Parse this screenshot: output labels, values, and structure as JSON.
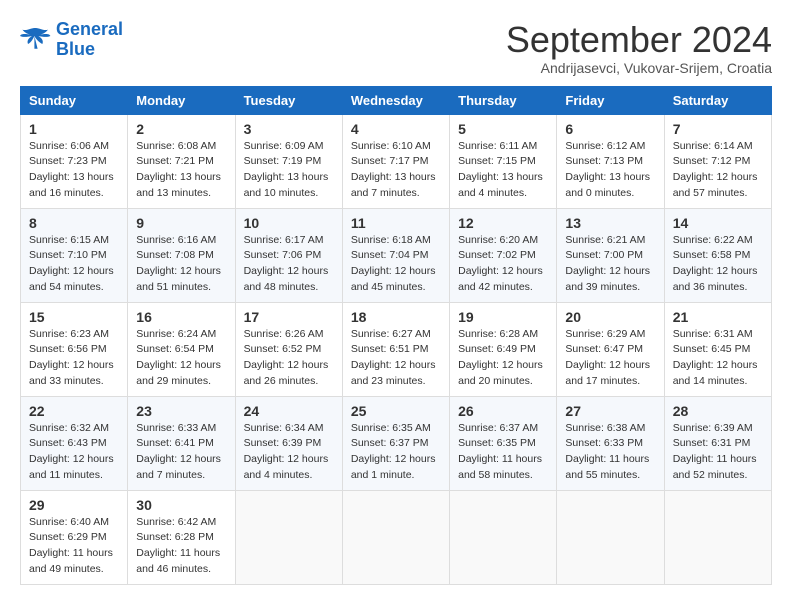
{
  "logo": {
    "line1": "General",
    "line2": "Blue"
  },
  "title": "September 2024",
  "subtitle": "Andrijasevci, Vukovar-Srijem, Croatia",
  "weekdays": [
    "Sunday",
    "Monday",
    "Tuesday",
    "Wednesday",
    "Thursday",
    "Friday",
    "Saturday"
  ],
  "weeks": [
    [
      {
        "day": "1",
        "sunrise": "6:06 AM",
        "sunset": "7:23 PM",
        "daylight": "13 hours and 16 minutes."
      },
      {
        "day": "2",
        "sunrise": "6:08 AM",
        "sunset": "7:21 PM",
        "daylight": "13 hours and 13 minutes."
      },
      {
        "day": "3",
        "sunrise": "6:09 AM",
        "sunset": "7:19 PM",
        "daylight": "13 hours and 10 minutes."
      },
      {
        "day": "4",
        "sunrise": "6:10 AM",
        "sunset": "7:17 PM",
        "daylight": "13 hours and 7 minutes."
      },
      {
        "day": "5",
        "sunrise": "6:11 AM",
        "sunset": "7:15 PM",
        "daylight": "13 hours and 4 minutes."
      },
      {
        "day": "6",
        "sunrise": "6:12 AM",
        "sunset": "7:13 PM",
        "daylight": "13 hours and 0 minutes."
      },
      {
        "day": "7",
        "sunrise": "6:14 AM",
        "sunset": "7:12 PM",
        "daylight": "12 hours and 57 minutes."
      }
    ],
    [
      {
        "day": "8",
        "sunrise": "6:15 AM",
        "sunset": "7:10 PM",
        "daylight": "12 hours and 54 minutes."
      },
      {
        "day": "9",
        "sunrise": "6:16 AM",
        "sunset": "7:08 PM",
        "daylight": "12 hours and 51 minutes."
      },
      {
        "day": "10",
        "sunrise": "6:17 AM",
        "sunset": "7:06 PM",
        "daylight": "12 hours and 48 minutes."
      },
      {
        "day": "11",
        "sunrise": "6:18 AM",
        "sunset": "7:04 PM",
        "daylight": "12 hours and 45 minutes."
      },
      {
        "day": "12",
        "sunrise": "6:20 AM",
        "sunset": "7:02 PM",
        "daylight": "12 hours and 42 minutes."
      },
      {
        "day": "13",
        "sunrise": "6:21 AM",
        "sunset": "7:00 PM",
        "daylight": "12 hours and 39 minutes."
      },
      {
        "day": "14",
        "sunrise": "6:22 AM",
        "sunset": "6:58 PM",
        "daylight": "12 hours and 36 minutes."
      }
    ],
    [
      {
        "day": "15",
        "sunrise": "6:23 AM",
        "sunset": "6:56 PM",
        "daylight": "12 hours and 33 minutes."
      },
      {
        "day": "16",
        "sunrise": "6:24 AM",
        "sunset": "6:54 PM",
        "daylight": "12 hours and 29 minutes."
      },
      {
        "day": "17",
        "sunrise": "6:26 AM",
        "sunset": "6:52 PM",
        "daylight": "12 hours and 26 minutes."
      },
      {
        "day": "18",
        "sunrise": "6:27 AM",
        "sunset": "6:51 PM",
        "daylight": "12 hours and 23 minutes."
      },
      {
        "day": "19",
        "sunrise": "6:28 AM",
        "sunset": "6:49 PM",
        "daylight": "12 hours and 20 minutes."
      },
      {
        "day": "20",
        "sunrise": "6:29 AM",
        "sunset": "6:47 PM",
        "daylight": "12 hours and 17 minutes."
      },
      {
        "day": "21",
        "sunrise": "6:31 AM",
        "sunset": "6:45 PM",
        "daylight": "12 hours and 14 minutes."
      }
    ],
    [
      {
        "day": "22",
        "sunrise": "6:32 AM",
        "sunset": "6:43 PM",
        "daylight": "12 hours and 11 minutes."
      },
      {
        "day": "23",
        "sunrise": "6:33 AM",
        "sunset": "6:41 PM",
        "daylight": "12 hours and 7 minutes."
      },
      {
        "day": "24",
        "sunrise": "6:34 AM",
        "sunset": "6:39 PM",
        "daylight": "12 hours and 4 minutes."
      },
      {
        "day": "25",
        "sunrise": "6:35 AM",
        "sunset": "6:37 PM",
        "daylight": "12 hours and 1 minute."
      },
      {
        "day": "26",
        "sunrise": "6:37 AM",
        "sunset": "6:35 PM",
        "daylight": "11 hours and 58 minutes."
      },
      {
        "day": "27",
        "sunrise": "6:38 AM",
        "sunset": "6:33 PM",
        "daylight": "11 hours and 55 minutes."
      },
      {
        "day": "28",
        "sunrise": "6:39 AM",
        "sunset": "6:31 PM",
        "daylight": "11 hours and 52 minutes."
      }
    ],
    [
      {
        "day": "29",
        "sunrise": "6:40 AM",
        "sunset": "6:29 PM",
        "daylight": "11 hours and 49 minutes."
      },
      {
        "day": "30",
        "sunrise": "6:42 AM",
        "sunset": "6:28 PM",
        "daylight": "11 hours and 46 minutes."
      },
      null,
      null,
      null,
      null,
      null
    ]
  ]
}
